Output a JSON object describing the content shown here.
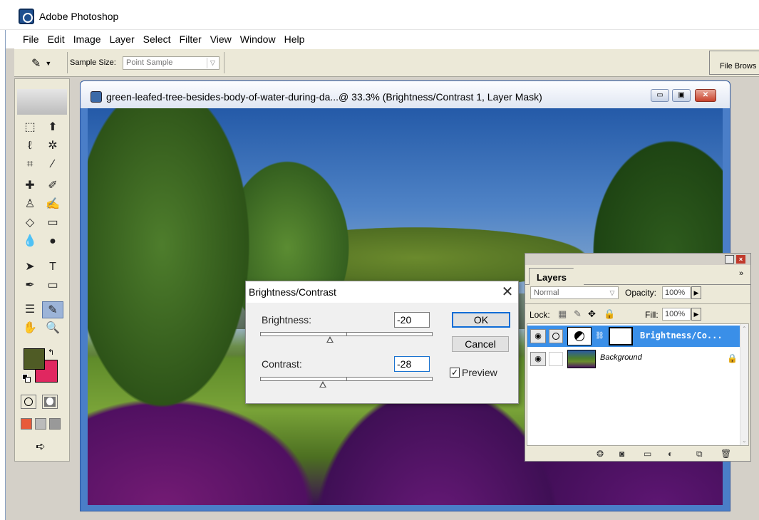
{
  "app": {
    "title": "Adobe Photoshop"
  },
  "menu": [
    "File",
    "Edit",
    "Image",
    "Layer",
    "Select",
    "Filter",
    "View",
    "Window",
    "Help"
  ],
  "options": {
    "sample_size_label": "Sample Size:",
    "sample_size_value": "Point Sample",
    "file_browser": "File Brows"
  },
  "document": {
    "title": "green-leafed-tree-besides-body-of-water-during-da...@ 33.3% (Brightness/Contrast 1, Layer Mask)",
    "minimize": "▭",
    "maximize": "▣",
    "close": "✕"
  },
  "colors": {
    "foreground": "#4f5b25",
    "background": "#e02760"
  },
  "dialog": {
    "title": "Brightness/Contrast",
    "close": "✕",
    "brightness_label": "Brightness:",
    "brightness_value": "-20",
    "contrast_label": "Contrast:",
    "contrast_value": "-28",
    "ok": "OK",
    "cancel": "Cancel",
    "preview_label": "Preview",
    "preview_check": "✓",
    "brightness_slider_pct": 40,
    "contrast_slider_pct": 36
  },
  "layers": {
    "tab": "Layers",
    "more": "»",
    "blend_mode": "Normal",
    "opacity_label": "Opacity:",
    "opacity_value": "100%",
    "lock_label": "Lock:",
    "fill_label": "Fill:",
    "fill_value": "100%",
    "items": [
      {
        "name": "Brightness/Co...",
        "selected": true
      },
      {
        "name": "Background",
        "selected": false
      }
    ]
  }
}
